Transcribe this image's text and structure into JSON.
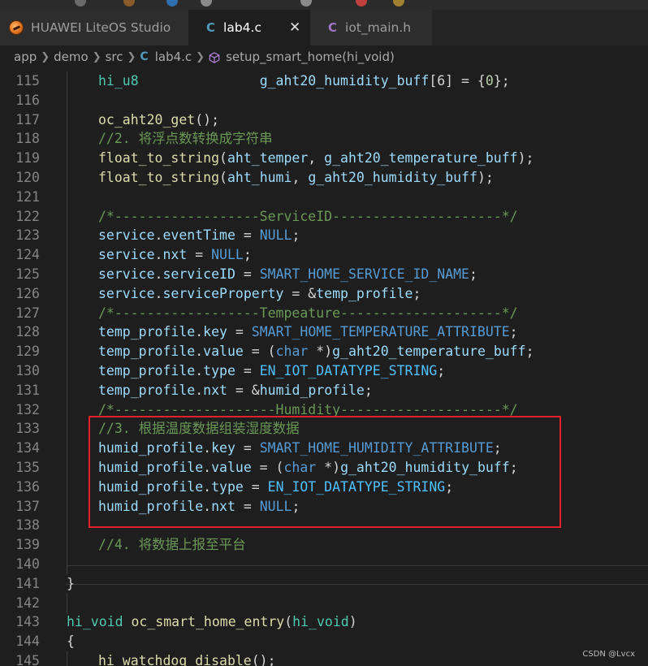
{
  "tabs": [
    {
      "label": "HUAWEI LiteOS Studio",
      "state": "inactive",
      "icon": "liteos-studio-icon"
    },
    {
      "label": "lab4.c",
      "state": "active",
      "icon": "c-file-icon",
      "icon_glyph": "C",
      "icon_color": "#519aba"
    },
    {
      "label": "iot_main.h",
      "state": "inactive",
      "icon": "h-file-icon",
      "icon_glyph": "C",
      "icon_color": "#a074c4"
    }
  ],
  "breadcrumb": {
    "items": [
      "app",
      "demo",
      "src",
      "lab4.c",
      "setup_smart_home(hi_void)"
    ],
    "file_icon_glyph": "C"
  },
  "colors": {
    "background": "#1e1e1e",
    "line_number": "#858585",
    "variable": "#9cdcfe",
    "function": "#dcdcaa",
    "type": "#4ec9b0",
    "keyword": "#569cd6",
    "comment": "#6a9955",
    "number": "#b5cea8",
    "highlight_box": "#e0202a"
  },
  "code_lines": [
    {
      "n": "115",
      "tokens": [
        [
          "type",
          "hi_u8"
        ],
        [
          "plain",
          "               "
        ],
        [
          "var",
          "g_aht20_humidity_buff"
        ],
        [
          "plain",
          "[6] = {"
        ],
        [
          "num",
          "0"
        ],
        [
          "plain",
          "};"
        ]
      ]
    },
    {
      "n": "116",
      "tokens": []
    },
    {
      "n": "117",
      "tokens": [
        [
          "fn",
          "oc_aht20_get"
        ],
        [
          "plain",
          "();"
        ]
      ]
    },
    {
      "n": "118",
      "tokens": [
        [
          "comment",
          "//2. 将浮点数转换成字符串"
        ]
      ]
    },
    {
      "n": "119",
      "tokens": [
        [
          "fn",
          "float_to_string"
        ],
        [
          "plain",
          "("
        ],
        [
          "var",
          "aht_temper"
        ],
        [
          "plain",
          ", "
        ],
        [
          "var",
          "g_aht20_temperature_buff"
        ],
        [
          "plain",
          ");"
        ]
      ]
    },
    {
      "n": "120",
      "tokens": [
        [
          "fn",
          "float_to_string"
        ],
        [
          "plain",
          "("
        ],
        [
          "var",
          "aht_humi"
        ],
        [
          "plain",
          ", "
        ],
        [
          "var",
          "g_aht20_humidity_buff"
        ],
        [
          "plain",
          ");"
        ]
      ]
    },
    {
      "n": "121",
      "tokens": []
    },
    {
      "n": "122",
      "tokens": [
        [
          "comment",
          "/*------------------ServiceID---------------------*/"
        ]
      ]
    },
    {
      "n": "123",
      "tokens": [
        [
          "var",
          "service"
        ],
        [
          "plain",
          "."
        ],
        [
          "var",
          "eventTime"
        ],
        [
          "plain",
          " = "
        ],
        [
          "macro",
          "NULL"
        ],
        [
          "plain",
          ";"
        ]
      ]
    },
    {
      "n": "124",
      "tokens": [
        [
          "var",
          "service"
        ],
        [
          "plain",
          "."
        ],
        [
          "var",
          "nxt"
        ],
        [
          "plain",
          " = "
        ],
        [
          "macro",
          "NULL"
        ],
        [
          "plain",
          ";"
        ]
      ]
    },
    {
      "n": "125",
      "tokens": [
        [
          "var",
          "service"
        ],
        [
          "plain",
          "."
        ],
        [
          "var",
          "serviceID"
        ],
        [
          "plain",
          " = "
        ],
        [
          "macro",
          "SMART_HOME_SERVICE_ID_NAME"
        ],
        [
          "plain",
          ";"
        ]
      ]
    },
    {
      "n": "126",
      "tokens": [
        [
          "var",
          "service"
        ],
        [
          "plain",
          "."
        ],
        [
          "var",
          "serviceProperty"
        ],
        [
          "plain",
          " = &"
        ],
        [
          "var",
          "temp_profile"
        ],
        [
          "plain",
          ";"
        ]
      ]
    },
    {
      "n": "127",
      "tokens": [
        [
          "comment",
          "/*------------------Tempeature--------------------*/"
        ]
      ]
    },
    {
      "n": "128",
      "tokens": [
        [
          "var",
          "temp_profile"
        ],
        [
          "plain",
          "."
        ],
        [
          "var",
          "key"
        ],
        [
          "plain",
          " = "
        ],
        [
          "macro",
          "SMART_HOME_TEMPERATURE_ATTRIBUTE"
        ],
        [
          "plain",
          ";"
        ]
      ]
    },
    {
      "n": "129",
      "tokens": [
        [
          "var",
          "temp_profile"
        ],
        [
          "plain",
          "."
        ],
        [
          "var",
          "value"
        ],
        [
          "plain",
          " = ("
        ],
        [
          "kw",
          "char"
        ],
        [
          "plain",
          " *)"
        ],
        [
          "var",
          "g_aht20_temperature_buff"
        ],
        [
          "plain",
          ";"
        ]
      ]
    },
    {
      "n": "130",
      "tokens": [
        [
          "var",
          "temp_profile"
        ],
        [
          "plain",
          "."
        ],
        [
          "var",
          "type"
        ],
        [
          "plain",
          " = "
        ],
        [
          "const",
          "EN_IOT_DATATYPE_STRING"
        ],
        [
          "plain",
          ";"
        ]
      ]
    },
    {
      "n": "131",
      "tokens": [
        [
          "var",
          "temp_profile"
        ],
        [
          "plain",
          "."
        ],
        [
          "var",
          "nxt"
        ],
        [
          "plain",
          " = &"
        ],
        [
          "var",
          "humid_profile"
        ],
        [
          "plain",
          ";"
        ]
      ]
    },
    {
      "n": "132",
      "tokens": [
        [
          "comment",
          "/*--------------------Humidity--------------------*/"
        ]
      ]
    },
    {
      "n": "133",
      "tokens": [
        [
          "comment",
          "//3. 根据温度数据组装湿度数据"
        ]
      ]
    },
    {
      "n": "134",
      "tokens": [
        [
          "var",
          "humid_profile"
        ],
        [
          "plain",
          "."
        ],
        [
          "var",
          "key"
        ],
        [
          "plain",
          " = "
        ],
        [
          "macro",
          "SMART_HOME_HUMIDITY_ATTRIBUTE"
        ],
        [
          "plain",
          ";"
        ]
      ]
    },
    {
      "n": "135",
      "tokens": [
        [
          "var",
          "humid_profile"
        ],
        [
          "plain",
          "."
        ],
        [
          "var",
          "value"
        ],
        [
          "plain",
          " = ("
        ],
        [
          "kw",
          "char"
        ],
        [
          "plain",
          " *)"
        ],
        [
          "var",
          "g_aht20_humidity_buff"
        ],
        [
          "plain",
          ";"
        ]
      ]
    },
    {
      "n": "136",
      "tokens": [
        [
          "var",
          "humid_profile"
        ],
        [
          "plain",
          "."
        ],
        [
          "var",
          "type"
        ],
        [
          "plain",
          " = "
        ],
        [
          "const",
          "EN_IOT_DATATYPE_STRING"
        ],
        [
          "plain",
          ";"
        ]
      ]
    },
    {
      "n": "137",
      "tokens": [
        [
          "var",
          "humid_profile"
        ],
        [
          "plain",
          "."
        ],
        [
          "var",
          "nxt"
        ],
        [
          "plain",
          " = "
        ],
        [
          "macro",
          "NULL"
        ],
        [
          "plain",
          ";"
        ]
      ]
    },
    {
      "n": "138",
      "tokens": []
    },
    {
      "n": "139",
      "tokens": [
        [
          "comment",
          "//4. 将数据上报至平台"
        ]
      ]
    },
    {
      "n": "140",
      "tokens": []
    },
    {
      "n": "141",
      "tokens": [
        [
          "plain",
          "}"
        ]
      ]
    },
    {
      "n": "142",
      "tokens": []
    },
    {
      "n": "143",
      "tokens": [
        [
          "type",
          "hi_void"
        ],
        [
          "plain",
          " "
        ],
        [
          "fn",
          "oc_smart_home_entry"
        ],
        [
          "plain",
          "("
        ],
        [
          "type",
          "hi_void"
        ],
        [
          "plain",
          ")"
        ]
      ]
    },
    {
      "n": "144",
      "tokens": [
        [
          "plain",
          "{"
        ]
      ]
    },
    {
      "n": "145",
      "tokens": [
        [
          "fn",
          "hi_watchdog_disable"
        ],
        [
          "plain",
          "();"
        ]
      ]
    }
  ],
  "watermark": "CSDN @Lvcx"
}
